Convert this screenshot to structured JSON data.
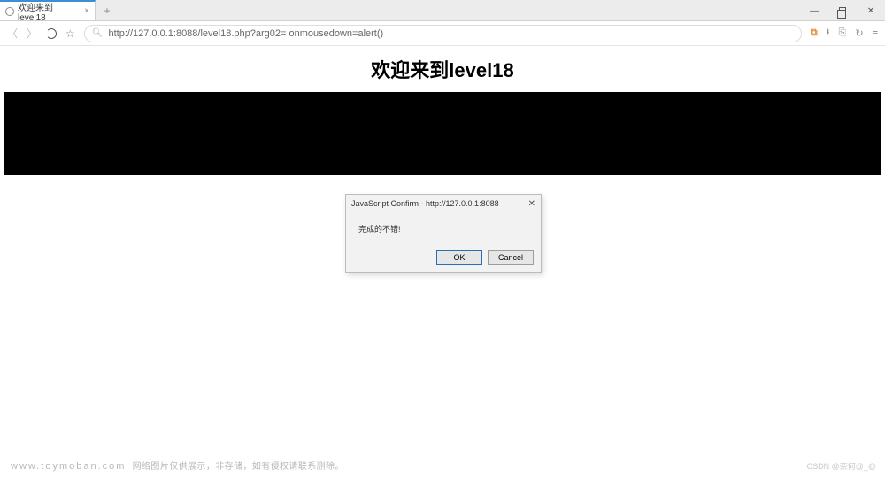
{
  "window": {
    "minimize": "—",
    "maximize": "",
    "close": "✕"
  },
  "tab": {
    "title": "欢迎来到level18",
    "close": "×"
  },
  "newtab_glyph": "+",
  "nav": {
    "back": "〈",
    "forward": "〉"
  },
  "address": {
    "url": "http://127.0.0.1:8088/level18.php?arg02= onmousedown=alert()"
  },
  "toolbar_right": {
    "dl_glyph": "⧉",
    "download_glyph": "⭳",
    "folder_glyph": "⎘",
    "history_glyph": "↻",
    "menu_glyph": "≡"
  },
  "page": {
    "heading": "欢迎来到level18"
  },
  "dialog": {
    "title": "JavaScript Confirm - http://127.0.0.1:8088",
    "message": "完成的不错!",
    "ok": "OK",
    "cancel": "Cancel",
    "close_glyph": "✕"
  },
  "footer": {
    "domain": "www.toymoban.com",
    "disclaimer": "网络图片仅供展示，非存储，如有侵权请联系删除。",
    "credit": "CSDN @奈何@_@"
  }
}
